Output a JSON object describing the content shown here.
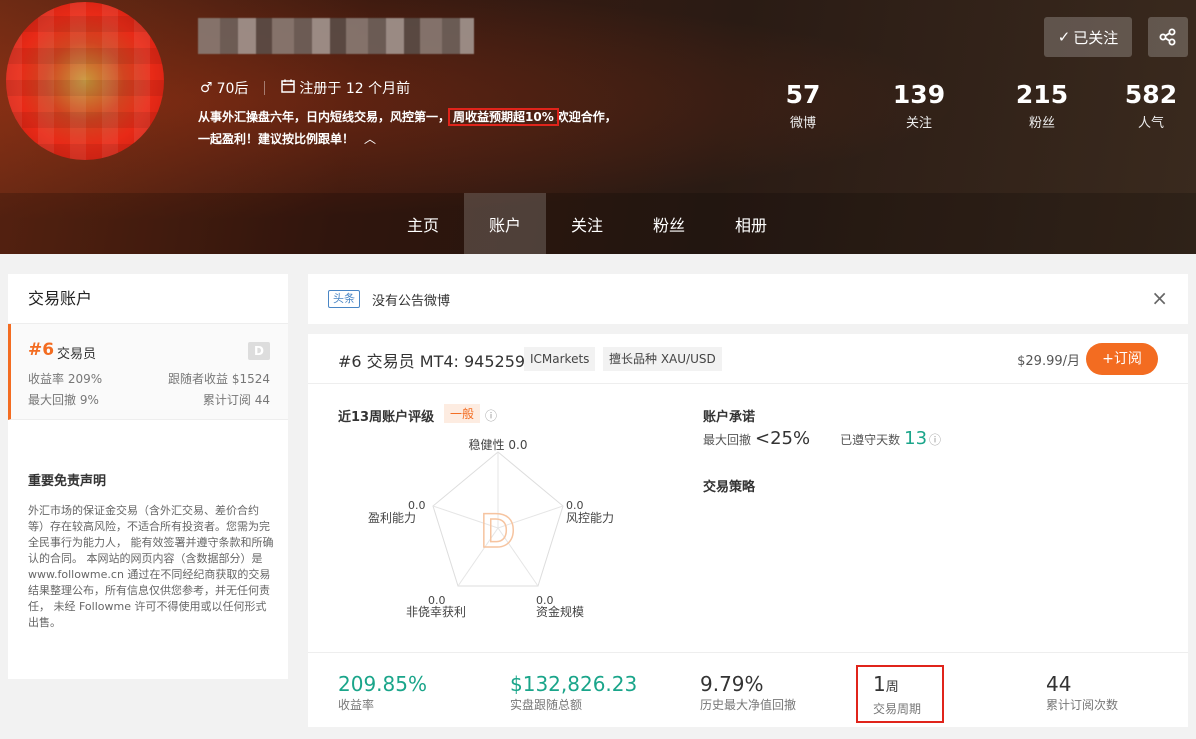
{
  "profile": {
    "age_tag": "70后",
    "registered": "注册于 12 个月前",
    "intro_before": "从事外汇操盘六年，日内短线交易，风控第一，",
    "intro_highlight": "周收益预期超10%",
    "intro_after": "欢迎合作，一起盈利！建议按比例跟单！",
    "follow_label": "已关注",
    "stats": [
      {
        "num": "57",
        "label": "微博"
      },
      {
        "num": "139",
        "label": "关注"
      },
      {
        "num": "215",
        "label": "粉丝"
      },
      {
        "num": "582",
        "label": "人气"
      }
    ]
  },
  "nav": [
    "主页",
    "账户",
    "关注",
    "粉丝",
    "相册"
  ],
  "nav_active": "账户",
  "left": {
    "title": "交易账户",
    "account": {
      "rank": "#6",
      "role": "交易员",
      "badge": "D",
      "yield_label": "收益率 209%",
      "follower_profit": "跟随者收益 $1524",
      "max_drawdown": "最大回撤 9%",
      "subscriptions": "累计订阅 44"
    },
    "disclaimer_title": "重要免责声明",
    "disclaimer_text": "外汇市场的保证金交易（含外汇交易、差价合约等）存在较高风险，不适合所有投资者。您需为完全民事行为能力人， 能有效签署并遵守条款和所确认的合同。 本网站的网页内容（含数据部分）是 www.followme.cn 通过在不同经纪商获取的交易结果整理公布，所有信息仅供您参考，并无任何责任， 未经 Followme 许可不得使用或以任何形式出售。"
  },
  "notice": {
    "tag": "头条",
    "text": "没有公告微博",
    "close": "×"
  },
  "card": {
    "title": "#6 交易员 MT4: 945259",
    "broker": "ICMarkets",
    "specialty": "擅长品种 XAU/USD",
    "price": "$29.99/月",
    "subscribe": "+订阅",
    "rating_title": "近13周账户评级",
    "rating_level": "一般",
    "radar_center": "D",
    "radar": [
      {
        "label": "稳健性",
        "value": "0.0"
      },
      {
        "label": "风控能力",
        "value": "0.0"
      },
      {
        "label": "资金规模",
        "value": "0.0"
      },
      {
        "label": "非侥幸获利",
        "value": "0.0"
      },
      {
        "label": "盈利能力",
        "value": "0.0"
      }
    ],
    "promise_title": "账户承诺",
    "promise_dd_label": "最大回撤",
    "promise_dd_value": "<25%",
    "promise_days_label": "已遵守天数",
    "promise_days_value": "13",
    "strategy_title": "交易策略",
    "kpis": [
      {
        "value": "209.85%",
        "label": "收益率"
      },
      {
        "value": "$132,826.23",
        "label": "实盘跟随总额"
      },
      {
        "value": "9.79%",
        "label": "历史最大净值回撤"
      },
      {
        "value": "1",
        "unit": "周",
        "label": "交易周期"
      },
      {
        "value": "44",
        "label": "累计订阅次数"
      }
    ]
  },
  "colors": {
    "accent": "#f36c21",
    "green": "#1aa58a",
    "highlight_border": "#e0241b"
  }
}
